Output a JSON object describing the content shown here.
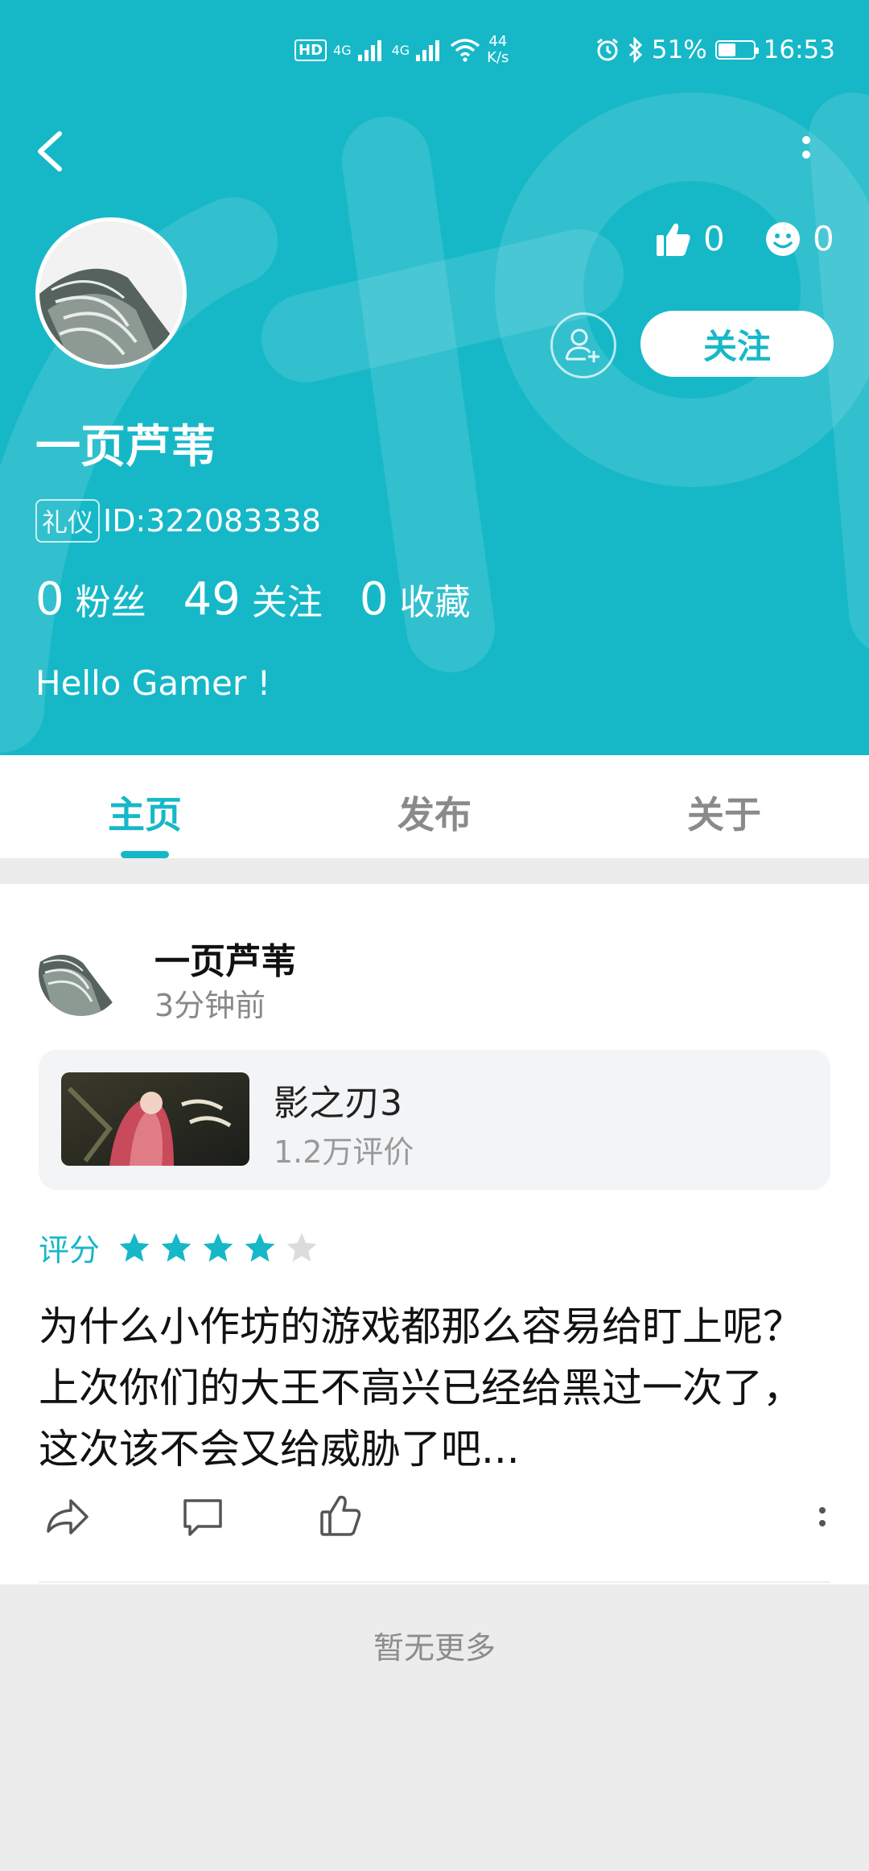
{
  "status_bar": {
    "hd": "HD",
    "net1": "4G",
    "net2": "4G",
    "speed_value": "44",
    "speed_unit": "K/s",
    "battery_text": "51%",
    "battery_level": 0.51,
    "time": "16:53"
  },
  "profile": {
    "likes": "0",
    "smiles": "0",
    "follow_label": "关注",
    "username": "一页芦苇",
    "tag": "礼仪",
    "id_text": "ID:322083338",
    "fans_count": "0",
    "fans_label": "粉丝",
    "following_count": "49",
    "following_label": "关注",
    "favorites_count": "0",
    "favorites_label": "收藏",
    "bio": "Hello Gamer !"
  },
  "tabs": [
    {
      "label": "主页",
      "active": true
    },
    {
      "label": "发布",
      "active": false
    },
    {
      "label": "关于",
      "active": false
    }
  ],
  "post": {
    "author": "一页芦苇",
    "time": "3分钟前",
    "game_name": "影之刃3",
    "game_reviews": "1.2万评价",
    "rating_label": "评分",
    "rating": 4,
    "rating_max": 5,
    "text": "为什么小作坊的游戏都那么容易给盯上呢？上次你们的大王不高兴已经给黑过一次了，这次该不会又给威胁了吧..."
  },
  "footer": {
    "no_more": "暂无更多"
  },
  "colors": {
    "accent": "#16b8c8",
    "star_inactive": "#dcdcdc"
  }
}
